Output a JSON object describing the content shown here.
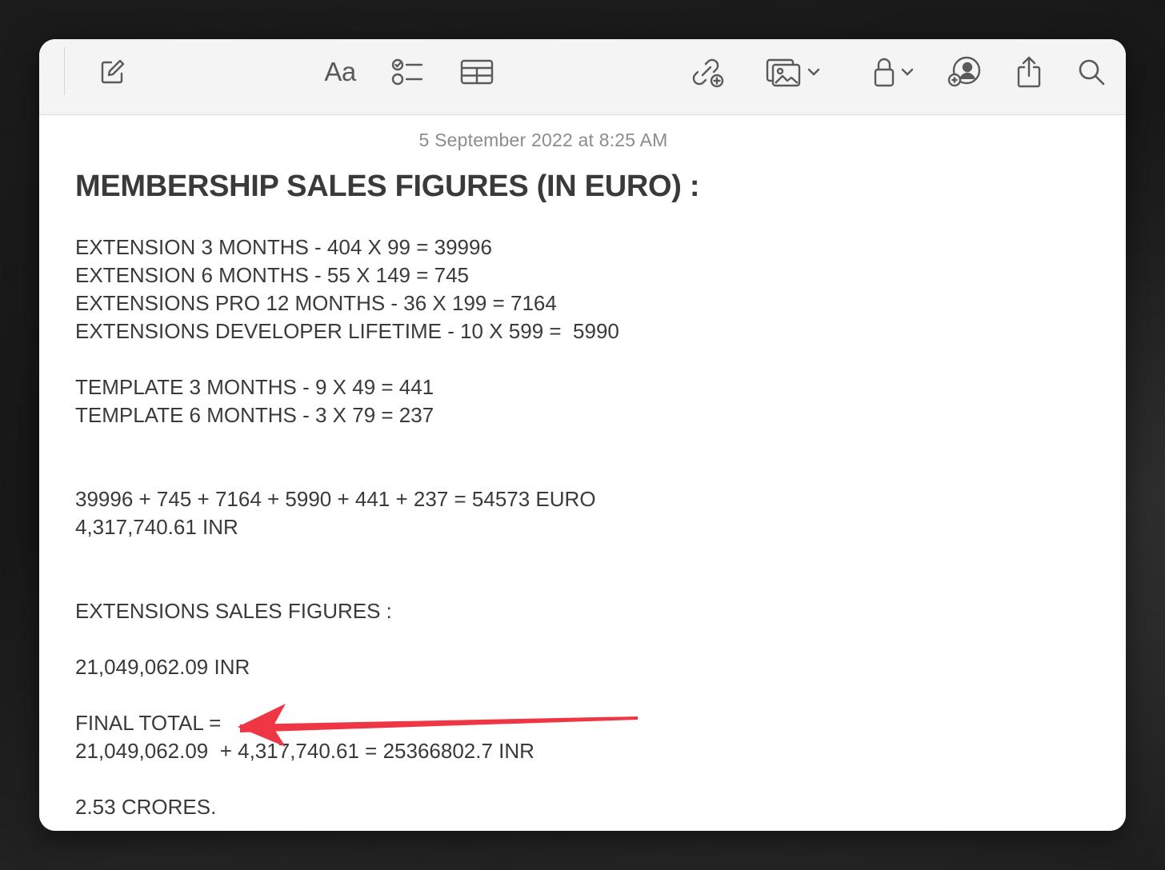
{
  "note": {
    "timestamp": "5 September 2022 at 8:25 AM",
    "title": "MEMBERSHIP SALES FIGURES (IN EURO) :",
    "lines": [
      "EXTENSION 3 MONTHS - 404 X 99 = 39996",
      "EXTENSION 6 MONTHS - 55 X 149 = 745",
      "EXTENSIONS PRO 12 MONTHS - 36 X 199 = 7164",
      "EXTENSIONS DEVELOPER LIFETIME - 10 X 599 =  5990",
      "TEMPLATE 3 MONTHS - 9 X 49 = 441",
      "TEMPLATE 6 MONTHS - 3 X 79 = 237",
      "39996 + 745 + 7164 + 5990 + 441 + 237 = 54573 EURO",
      "4,317,740.61 INR",
      "EXTENSIONS SALES FIGURES :",
      "21,049,062.09 INR",
      "FINAL TOTAL =",
      "21,049,062.09  + 4,317,740.61 = 25366802.7 INR",
      "2.53 CRORES."
    ]
  },
  "toolbar": {
    "format_label": "Aa",
    "icons": [
      "compose-icon",
      "checklist-icon",
      "table-icon",
      "link-add-icon",
      "media-icon",
      "lock-icon",
      "collaborate-icon",
      "share-icon",
      "search-icon"
    ]
  },
  "colors": {
    "annotation_arrow": "#ef3645",
    "toolbar_bg": "#f4f4f4",
    "text": "#3a3a3a",
    "timestamp": "#8c8c8c"
  }
}
